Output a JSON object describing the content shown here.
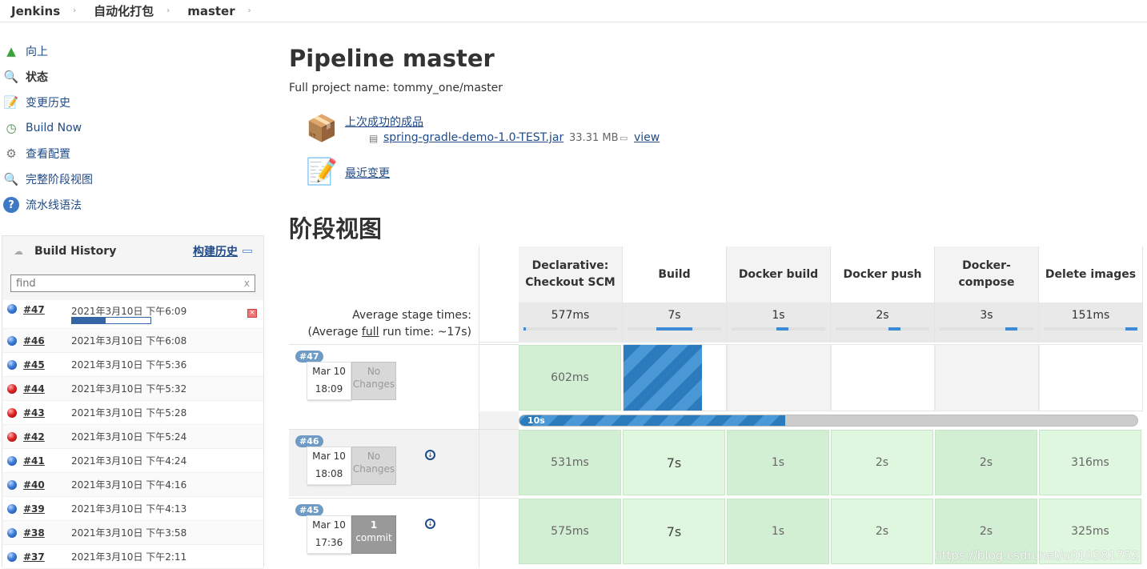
{
  "breadcrumb": [
    "Jenkins",
    "自动化打包",
    "master"
  ],
  "tasks": [
    {
      "label": "向上",
      "icon": "up-arrow-icon"
    },
    {
      "label": "状态",
      "icon": "magnifier-icon"
    },
    {
      "label": "变更历史",
      "icon": "notepad-icon"
    },
    {
      "label": "Build Now",
      "icon": "clock-play-icon"
    },
    {
      "label": "查看配置",
      "icon": "gear-icon"
    },
    {
      "label": "完整阶段视图",
      "icon": "magnifier-icon"
    },
    {
      "label": "流水线语法",
      "icon": "help-icon"
    }
  ],
  "build_history": {
    "title": "Build History",
    "trend": "构建历史",
    "search_placeholder": "find",
    "builds": [
      {
        "num": "#47",
        "date": "2021年3月10日 下午6:09",
        "status": "blue",
        "running": true,
        "progress": 0.43
      },
      {
        "num": "#46",
        "date": "2021年3月10日 下午6:08",
        "status": "blue"
      },
      {
        "num": "#45",
        "date": "2021年3月10日 下午5:36",
        "status": "blue"
      },
      {
        "num": "#44",
        "date": "2021年3月10日 下午5:32",
        "status": "red"
      },
      {
        "num": "#43",
        "date": "2021年3月10日 下午5:28",
        "status": "red"
      },
      {
        "num": "#42",
        "date": "2021年3月10日 下午5:24",
        "status": "red"
      },
      {
        "num": "#41",
        "date": "2021年3月10日 下午4:24",
        "status": "blue"
      },
      {
        "num": "#40",
        "date": "2021年3月10日 下午4:16",
        "status": "blue"
      },
      {
        "num": "#39",
        "date": "2021年3月10日 下午4:13",
        "status": "blue"
      },
      {
        "num": "#38",
        "date": "2021年3月10日 下午3:58",
        "status": "blue"
      },
      {
        "num": "#37",
        "date": "2021年3月10日 下午2:11",
        "status": "blue"
      }
    ]
  },
  "main": {
    "title": "Pipeline master",
    "full_name": "Full project name: tommy_one/master",
    "last_success": "上次成功的成品",
    "artifact": "spring-gradle-demo-1.0-TEST.jar",
    "artifact_size": "33.31 MB",
    "view": "view",
    "recent_changes": "最近变更",
    "stage_view": "阶段视图"
  },
  "stage_view": {
    "avg_label": "Average stage times:",
    "avg_full_pre": "(Average ",
    "avg_full_link": "full",
    "avg_full_post": " run time: ~17s)",
    "stages": [
      {
        "name": "Declarative:\nCheckout SCM",
        "avg": "577ms",
        "avg_frac": 0.0
      },
      {
        "name": "Build",
        "avg": "7s",
        "avg_frac": 0.5
      },
      {
        "name": "Docker build",
        "avg": "1s",
        "avg_frac": 0.55
      },
      {
        "name": "Docker push",
        "avg": "2s",
        "avg_frac": 0.65
      },
      {
        "name": "Docker-\ncompose",
        "avg": "3s",
        "avg_frac": 0.8
      },
      {
        "name": "Delete images",
        "avg": "151ms",
        "avg_frac": 1.0
      }
    ],
    "runs": [
      {
        "tag": "#47",
        "date": "Mar 10",
        "time": "18:09",
        "changes": "No\nChanges",
        "cells": [
          "602ms",
          "running",
          "",
          "",
          "",
          ""
        ],
        "run_progress_label": "10s",
        "run_progress": 0.43
      },
      {
        "tag": "#46",
        "date": "Mar 10",
        "time": "18:08",
        "changes": "No\nChanges",
        "download": true,
        "cells": [
          "531ms",
          "7s",
          "1s",
          "2s",
          "2s",
          "316ms"
        ]
      },
      {
        "tag": "#45",
        "date": "Mar 10",
        "time": "17:36",
        "changes_count": "1",
        "changes_unit": "commit",
        "download": true,
        "cells": [
          "575ms",
          "7s",
          "1s",
          "2s",
          "2s",
          "325ms"
        ]
      }
    ]
  },
  "watermark": "https://blog.csdn.net/u010381752"
}
